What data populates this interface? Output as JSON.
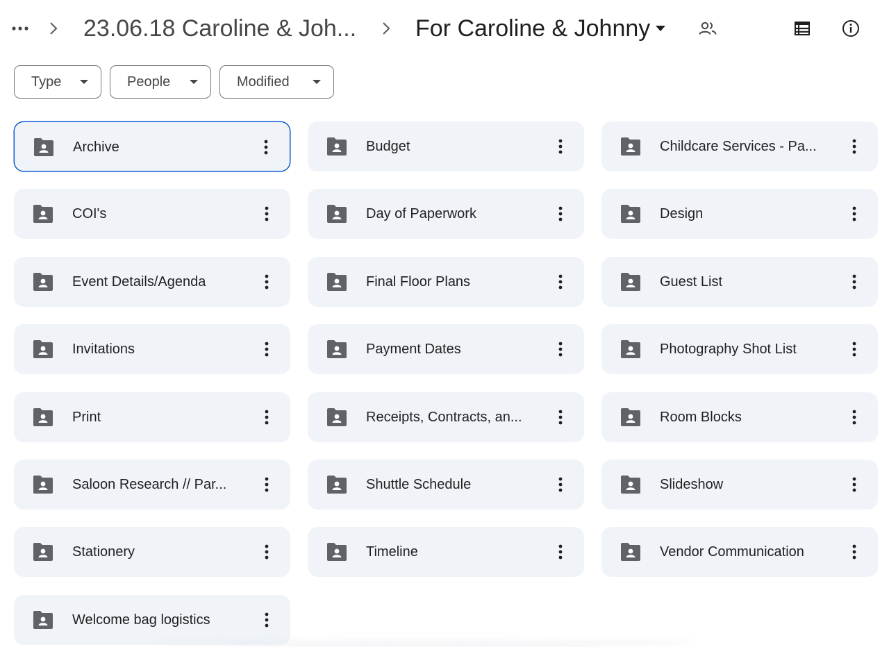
{
  "breadcrumb": {
    "more_icon": "more-horiz-icon",
    "parent_label": "23.06.18 Caroline & Joh...",
    "current_label": "For Caroline & Johnny",
    "shared_icon": "people-icon"
  },
  "toolbar": {
    "list_view_icon": "list-view-icon",
    "details_icon": "info-icon"
  },
  "filters": [
    {
      "label": "Type"
    },
    {
      "label": "People"
    },
    {
      "label": "Modified"
    }
  ],
  "folders": [
    {
      "name": "Archive",
      "selected": true
    },
    {
      "name": "Budget"
    },
    {
      "name": "Childcare Services - Pa..."
    },
    {
      "name": "COI's"
    },
    {
      "name": "Day of Paperwork"
    },
    {
      "name": "Design"
    },
    {
      "name": "Event Details/Agenda"
    },
    {
      "name": "Final Floor Plans"
    },
    {
      "name": "Guest List"
    },
    {
      "name": "Invitations"
    },
    {
      "name": "Payment Dates"
    },
    {
      "name": "Photography Shot List"
    },
    {
      "name": "Print"
    },
    {
      "name": "Receipts, Contracts, an..."
    },
    {
      "name": "Room Blocks"
    },
    {
      "name": "Saloon Research // Par..."
    },
    {
      "name": "Shuttle Schedule"
    },
    {
      "name": "Slideshow"
    },
    {
      "name": "Stationery"
    },
    {
      "name": "Timeline"
    },
    {
      "name": "Vendor Communication"
    },
    {
      "name": "Welcome bag logistics"
    }
  ],
  "colors": {
    "folder_bg": "#f0f4f9",
    "folder_icon": "#5f6368",
    "selected_border": "#0b57d0"
  }
}
